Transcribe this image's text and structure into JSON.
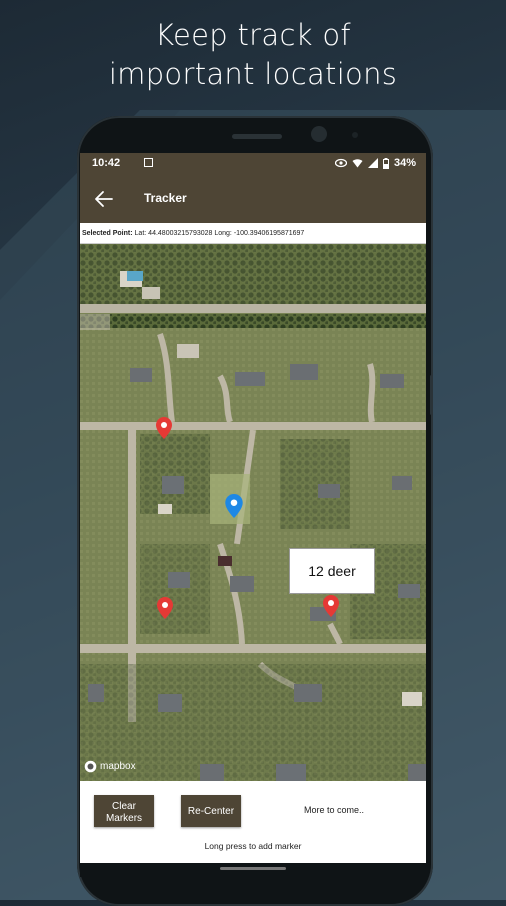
{
  "headline": {
    "line1": "Keep track of",
    "line2": "important locations"
  },
  "status_bar": {
    "time": "10:42",
    "battery": "34%",
    "icons": [
      "image-icon",
      "eye-icon",
      "wifi-icon",
      "signal-icon",
      "battery-icon"
    ]
  },
  "app_bar": {
    "title": "Tracker",
    "back_icon": "arrow-left-icon"
  },
  "selected_point": {
    "label": "Selected Point:",
    "lat_label": "Lat:",
    "lat": "44.48003215793028",
    "long_label": "Long:",
    "long": "-100.39406195871697"
  },
  "map": {
    "attribution": "mapbox",
    "markers": [
      {
        "color": "#e53935",
        "label": ""
      },
      {
        "color": "#1e88e5",
        "label": ""
      },
      {
        "color": "#e53935",
        "label": ""
      },
      {
        "color": "#e53935",
        "label": "12 deer"
      }
    ]
  },
  "controls": {
    "clear_line1": "Clear",
    "clear_line2": "Markers",
    "recenter": "Re-Center",
    "more": "More to come..",
    "hint": "Long press to add marker"
  },
  "colors": {
    "app_bar": "#4e4535",
    "button": "#4e4535",
    "marker_red": "#e53935",
    "marker_blue": "#1e88e5"
  }
}
